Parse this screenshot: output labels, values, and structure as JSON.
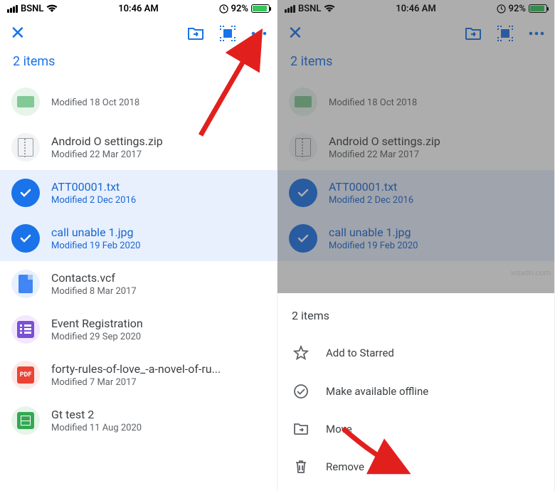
{
  "status": {
    "carrier": "BSNL",
    "time": "10:46 AM",
    "battery_pct": "92%"
  },
  "left": {
    "header_count": "2 items",
    "files": [
      {
        "name": "",
        "sub": "Modified 18 Oct 2018"
      },
      {
        "name": "Android O settings.zip",
        "sub": "Modified 22 Mar 2017"
      },
      {
        "name": "ATT00001.txt",
        "sub": "Modified 2 Dec 2016"
      },
      {
        "name": "call unable 1.jpg",
        "sub": "Modified 19 Feb 2020"
      },
      {
        "name": "Contacts.vcf",
        "sub": "Modified 8 Mar 2017"
      },
      {
        "name": "Event Registration",
        "sub": "Modified 29 Sep 2020"
      },
      {
        "name": "forty-rules-of-love_-a-novel-of-ru...",
        "sub": "Modified 7 Mar 2017"
      },
      {
        "name": "Gt test 2",
        "sub": "Modified 11 Aug 2020"
      }
    ]
  },
  "right": {
    "header_count": "2 items",
    "files_visible": [
      {
        "name": "",
        "sub": "Modified 18 Oct 2018"
      },
      {
        "name": "Android O settings.zip",
        "sub": "Modified 22 Mar 2017"
      },
      {
        "name": "ATT00001.txt",
        "sub": "Modified 2 Dec 2016"
      },
      {
        "name": "call unable 1.jpg",
        "sub": "Modified 19 Feb 2020"
      }
    ],
    "sheet_title": "2 items",
    "sheet_actions": {
      "starred": "Add to Starred",
      "offline": "Make available offline",
      "move": "Move",
      "remove": "Remove"
    }
  },
  "watermark": "wsxdn.com"
}
